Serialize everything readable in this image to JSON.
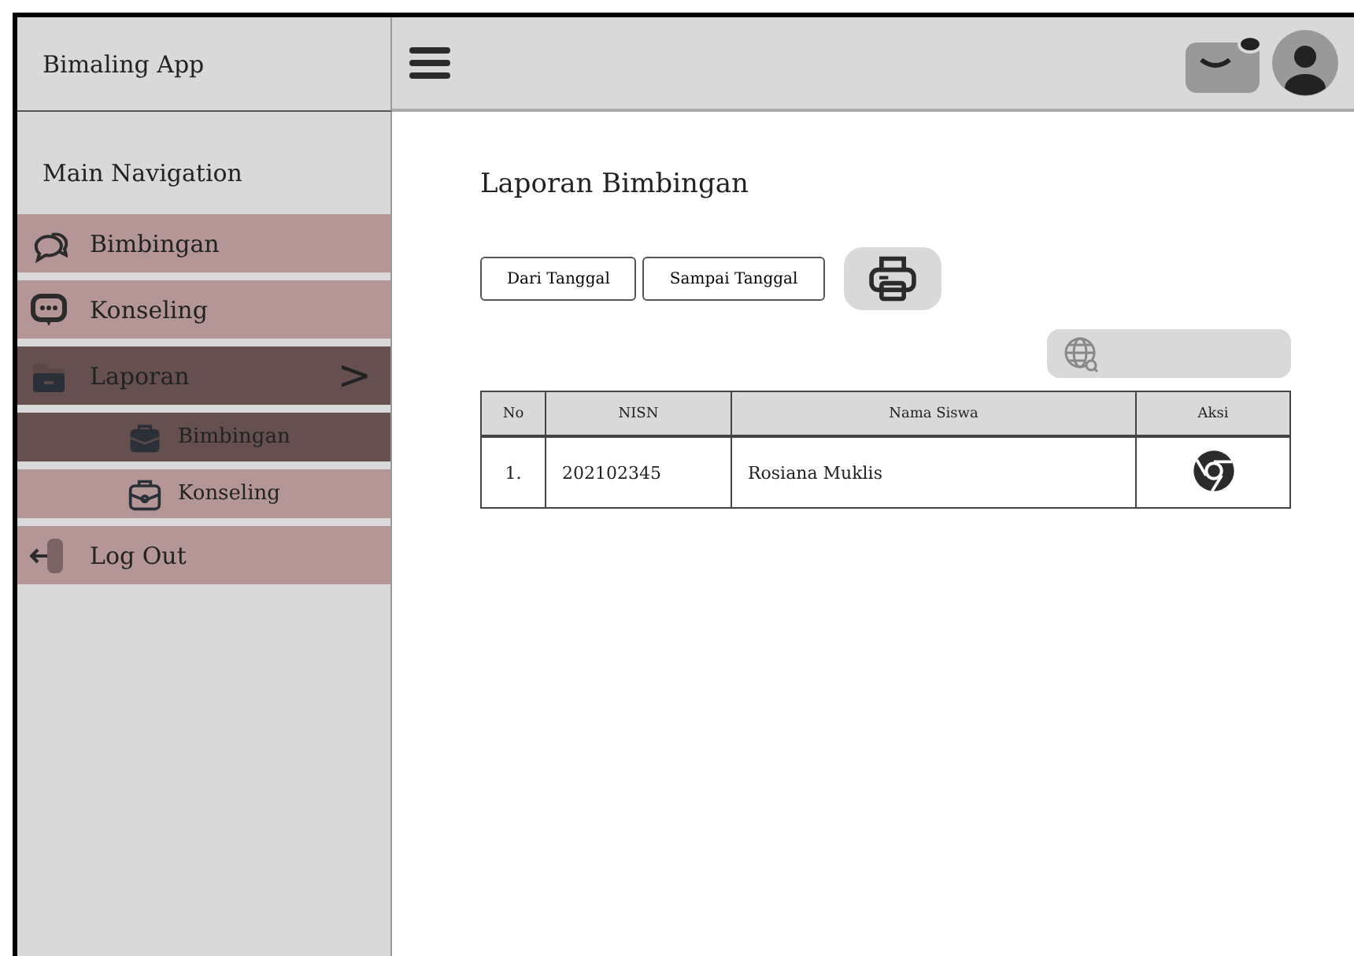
{
  "app": {
    "title": "Bimaling App"
  },
  "sidebar": {
    "heading": "Main Navigation",
    "items": [
      {
        "label": "Bimbingan",
        "kind": "main",
        "selected": false
      },
      {
        "label": "Konseling",
        "kind": "main",
        "selected": false
      },
      {
        "label": "Laporan",
        "kind": "main",
        "selected": true,
        "chevron": ">"
      },
      {
        "label": "Bimbingan",
        "kind": "sub",
        "selected": true
      },
      {
        "label": "Konseling",
        "kind": "sub",
        "selected": false
      },
      {
        "label": "Log Out",
        "kind": "main",
        "selected": false
      }
    ]
  },
  "page": {
    "title": "Laporan Bimbingan"
  },
  "filters": [
    "Dari Tanggal",
    "Sampai Tanggal"
  ],
  "table": {
    "columns": [
      "No",
      "NISN",
      "Nama Siswa",
      "Aksi"
    ],
    "rows": [
      {
        "no": "1.",
        "nisn": "202102345",
        "name": "Rosiana Muklis"
      }
    ]
  }
}
